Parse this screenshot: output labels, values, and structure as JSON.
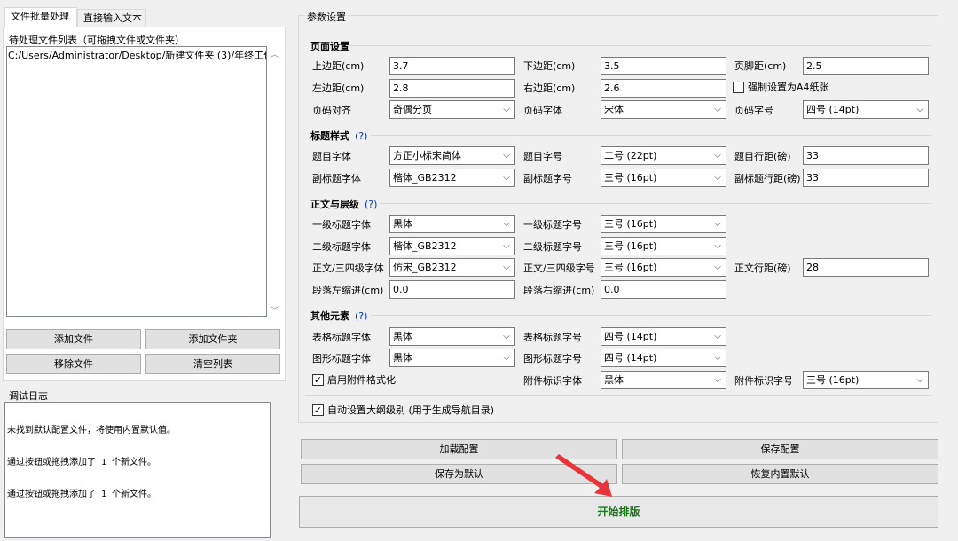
{
  "tabs": [
    "文件批量处理",
    "直接输入文本"
  ],
  "file_list": {
    "group_title": "待处理文件列表（可拖拽文件或文件夹）",
    "items": [
      "C:/Users/Administrator/Desktop/新建文件夹 (3)/年终工作"
    ]
  },
  "file_buttons": {
    "add_file": "添加文件",
    "add_folder": "添加文件夹",
    "remove_file": "移除文件",
    "clear_list": "清空列表"
  },
  "log": {
    "title": "调试日志",
    "lines": [
      "未找到默认配置文件，将使用内置默认值。",
      "通过按钮或拖拽添加了 1 个新文件。",
      "通过按钮或拖拽添加了 1 个新文件。"
    ]
  },
  "params": {
    "title": "参数设置",
    "help_mark": "(?)",
    "page": {
      "title": "页面设置",
      "top_margin_label": "上边距(cm)",
      "top_margin": "3.7",
      "bottom_margin_label": "下边距(cm)",
      "bottom_margin": "3.5",
      "footer_margin_label": "页脚距(cm)",
      "footer_margin": "2.5",
      "left_margin_label": "左边距(cm)",
      "left_margin": "2.8",
      "right_margin_label": "右边距(cm)",
      "right_margin": "2.6",
      "force_a4_label": "强制设置为A4纸张",
      "force_a4": false,
      "page_align_label": "页码对齐",
      "page_align": "奇偶分页",
      "page_font_label": "页码字体",
      "page_font": "宋体",
      "page_size_label": "页码字号",
      "page_size": "四号 (14pt)"
    },
    "title_style": {
      "title": "标题样式",
      "title_font_label": "题目字体",
      "title_font": "方正小标宋简体",
      "title_size_label": "题目字号",
      "title_size": "二号 (22pt)",
      "title_spacing_label": "题目行距(磅)",
      "title_spacing": "33",
      "subtitle_font_label": "副标题字体",
      "subtitle_font": "楷体_GB2312",
      "subtitle_size_label": "副标题字号",
      "subtitle_size": "三号 (16pt)",
      "subtitle_spacing_label": "副标题行距(磅)",
      "subtitle_spacing": "33"
    },
    "body": {
      "title": "正文与层级",
      "h1_font_label": "一级标题字体",
      "h1_font": "黑体",
      "h1_size_label": "一级标题字号",
      "h1_size": "三号 (16pt)",
      "h2_font_label": "二级标题字体",
      "h2_font": "楷体_GB2312",
      "h2_size_label": "二级标题字号",
      "h2_size": "三号 (16pt)",
      "body_font_label": "正文/三四级字体",
      "body_font": "仿宋_GB2312",
      "body_size_label": "正文/三四级字号",
      "body_size": "三号 (16pt)",
      "body_spacing_label": "正文行距(磅)",
      "body_spacing": "28",
      "left_indent_label": "段落左缩进(cm)",
      "left_indent": "0.0",
      "right_indent_label": "段落右缩进(cm)",
      "right_indent": "0.0"
    },
    "other": {
      "title": "其他元素",
      "table_title_font_label": "表格标题字体",
      "table_title_font": "黑体",
      "table_title_size_label": "表格标题字号",
      "table_title_size": "四号 (14pt)",
      "figure_title_font_label": "图形标题字体",
      "figure_title_font": "黑体",
      "figure_title_size_label": "图形标题字号",
      "figure_title_size": "四号 (14pt)",
      "attachment_format_label": "启用附件格式化",
      "attachment_format": true,
      "attachment_font_label": "附件标识字体",
      "attachment_font": "黑体",
      "attachment_size_label": "附件标识字号",
      "attachment_size": "三号 (16pt)"
    },
    "auto_outline_label": "自动设置大纲级别 (用于生成导航目录)",
    "auto_outline": true
  },
  "config_buttons": {
    "load": "加载配置",
    "save": "保存配置",
    "save_default": "保存为默认",
    "restore_default": "恢复内置默认"
  },
  "start_button": "开始排版",
  "check_mark": "✓",
  "arrow_glyph": "⌵"
}
